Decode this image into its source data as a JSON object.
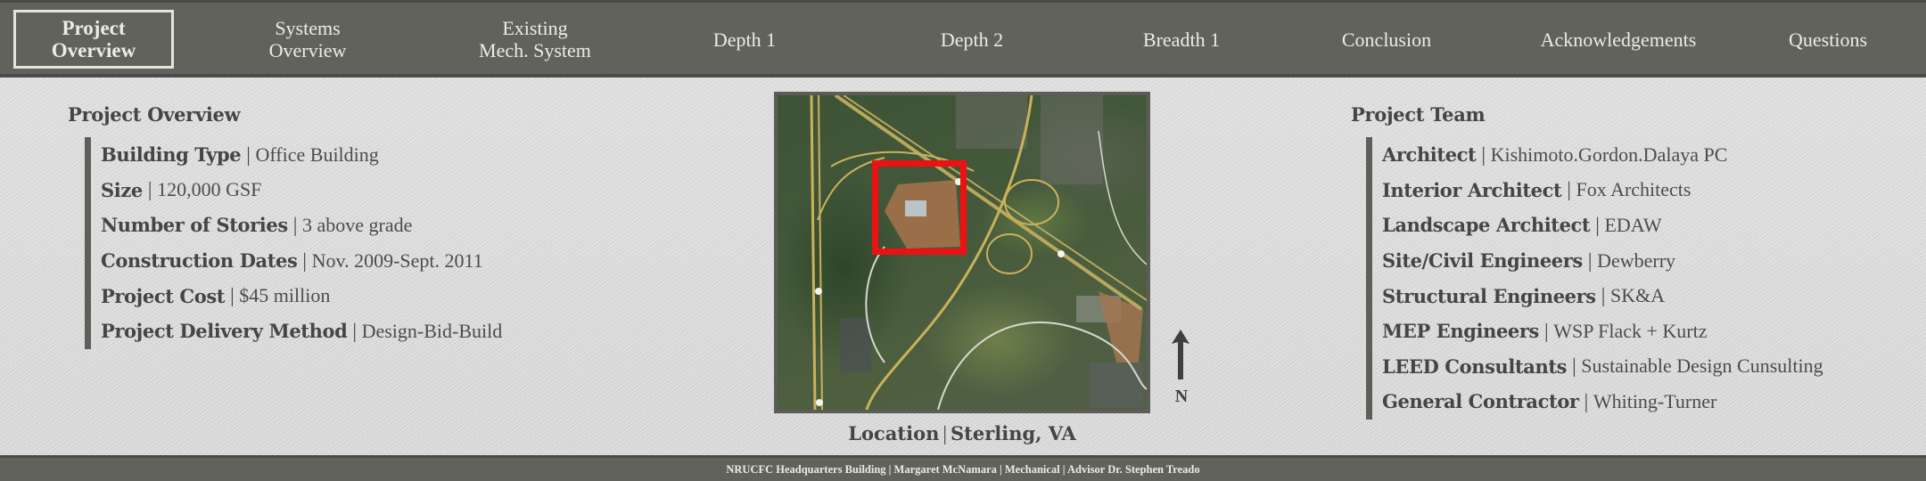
{
  "nav": {
    "items": [
      {
        "label": "Project\nOverview",
        "active": true
      },
      {
        "label": "Systems\nOverview",
        "active": false
      },
      {
        "label": "Existing\nMech. System",
        "active": false
      },
      {
        "label": "Depth 1",
        "active": false
      },
      {
        "label": "Depth 2",
        "active": false
      },
      {
        "label": "Breadth 1",
        "active": false
      },
      {
        "label": "Conclusion",
        "active": false
      },
      {
        "label": "Acknowledgements",
        "active": false
      },
      {
        "label": "Questions",
        "active": false
      }
    ]
  },
  "overview": {
    "title": "Project Overview",
    "separator": "|",
    "rows": [
      {
        "label": "Building Type",
        "value": "Office Building"
      },
      {
        "label": "Size",
        "value": "120,000 GSF"
      },
      {
        "label": "Number of Stories",
        "value": "3 above grade"
      },
      {
        "label": "Construction Dates",
        "value": "Nov. 2009-Sept. 2011"
      },
      {
        "label": "Project Cost",
        "value": "$45 million"
      },
      {
        "label": "Project Delivery Method",
        "value": "Design-Bid-Build"
      }
    ]
  },
  "map": {
    "image_description": "Aerial satellite view of site with project location highlighted",
    "highlight_color": "#ee1111",
    "location_label": "Location",
    "location_separator": "|",
    "location_value": "Sterling, VA",
    "north_label": "N"
  },
  "team": {
    "title": "Project Team",
    "separator": "|",
    "rows": [
      {
        "label": "Architect",
        "value": "Kishimoto.Gordon.Dalaya PC"
      },
      {
        "label": "Interior Architect",
        "value": "Fox Architects"
      },
      {
        "label": "Landscape Architect",
        "value": "EDAW"
      },
      {
        "label": "Site/Civil Engineers",
        "value": "Dewberry"
      },
      {
        "label": "Structural Engineers",
        "value": "SK&A"
      },
      {
        "label": "MEP Engineers",
        "value": "WSP Flack + Kurtz"
      },
      {
        "label": "LEED Consultants",
        "value": "Sustainable Design Cunsulting"
      },
      {
        "label": "General Contractor",
        "value": "Whiting-Turner"
      }
    ]
  },
  "footer": {
    "text": "NRUCFC Headquarters Building | Margaret McNamara  | Mechanical | Advisor Dr. Stephen Treado"
  },
  "colors": {
    "nav_bg": "#62625d",
    "nav_border": "#4a4a46",
    "nav_text": "#ecece6",
    "body_text": "#454542",
    "accent_bar": "#5e5e5a"
  }
}
